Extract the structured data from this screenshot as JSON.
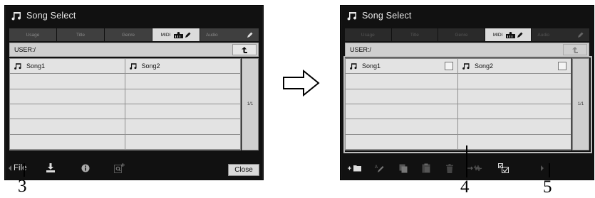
{
  "app_title": "Song Select",
  "tabs": [
    "Usage",
    "Title",
    "Genre",
    "MIDI",
    "Audio"
  ],
  "active_tab": "MIDI",
  "path": "USER:/",
  "songs": [
    "Song1",
    "Song2"
  ],
  "page_indicator": "1/1",
  "left_screen": {
    "file_label": "File",
    "close_label": "Close",
    "bottom_icons": [
      "left-arrow-icon",
      "save-icon",
      "info-icon",
      "search-icon"
    ]
  },
  "right_screen": {
    "bottom_icons": [
      "new-folder-icon",
      "rename-icon",
      "copy-icon",
      "paste-icon",
      "delete-icon",
      "move-icon",
      "select-all-icon",
      "right-arrow-icon"
    ]
  },
  "callouts": [
    "3",
    "4",
    "5"
  ],
  "colors": {
    "screen_bg": "#111111",
    "tab_inactive": "#3f3f3f",
    "tab_active": "#dcdcdc",
    "list_bg": "#e3e3e3"
  }
}
